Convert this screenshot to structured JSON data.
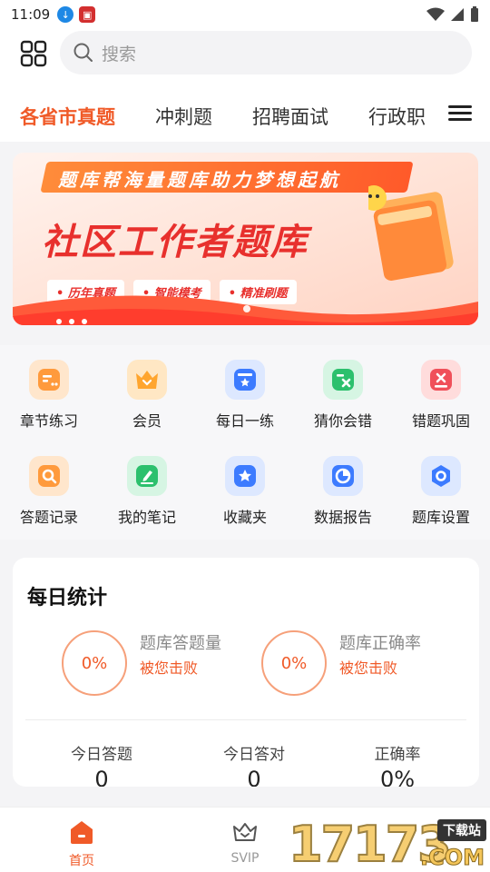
{
  "status_bar": {
    "time": "11:09"
  },
  "search": {
    "placeholder": "搜索"
  },
  "tabs": [
    {
      "label": "各省市真题",
      "active": true
    },
    {
      "label": "冲刺题",
      "active": false
    },
    {
      "label": "招聘面试",
      "active": false
    },
    {
      "label": "行政职",
      "active": false
    }
  ],
  "banner": {
    "top_text": "题库帮海量题库助力梦想起航",
    "title": "社区工作者题库",
    "pills": [
      "• 历年真题",
      "• 智能模考",
      "• 精准刷题"
    ]
  },
  "shortcuts": [
    {
      "label": "章节练习",
      "icon": "chapter-practice-icon",
      "color": "#ff9a3c"
    },
    {
      "label": "会员",
      "icon": "crown-icon",
      "color": "#ffa52e"
    },
    {
      "label": "每日一练",
      "icon": "daily-practice-icon",
      "color": "#3c7bff"
    },
    {
      "label": "猜你会错",
      "icon": "guess-wrong-icon",
      "color": "#2cc06d"
    },
    {
      "label": "错题巩固",
      "icon": "wrong-review-icon",
      "color": "#f0505a"
    },
    {
      "label": "答题记录",
      "icon": "answer-record-icon",
      "color": "#ff9a3c"
    },
    {
      "label": "我的笔记",
      "icon": "notes-icon",
      "color": "#2cc06d"
    },
    {
      "label": "收藏夹",
      "icon": "favorites-icon",
      "color": "#3c7bff"
    },
    {
      "label": "数据报告",
      "icon": "data-report-icon",
      "color": "#3c7bff"
    },
    {
      "label": "题库设置",
      "icon": "settings-icon",
      "color": "#3c7bff"
    }
  ],
  "daily_stats": {
    "title": "每日统计",
    "answer_volume": {
      "value": "0%",
      "label": "题库答题量",
      "sub": "被您击败"
    },
    "accuracy": {
      "value": "0%",
      "label": "题库正确率",
      "sub": "被您击败"
    },
    "columns": [
      {
        "label": "今日答题",
        "value": "0"
      },
      {
        "label": "今日答对",
        "value": "0"
      },
      {
        "label": "正确率",
        "value": "0%"
      }
    ]
  },
  "bottom_nav": [
    {
      "label": "首页",
      "icon": "home-icon",
      "active": true
    },
    {
      "label": "SVIP",
      "icon": "crown-outline-icon",
      "active": false
    }
  ],
  "watermark": {
    "number": "17173",
    "tag": "下载站",
    "domain": ".COM"
  },
  "colors": {
    "accent": "#f05a28",
    "banner_red": "#e8302d"
  }
}
